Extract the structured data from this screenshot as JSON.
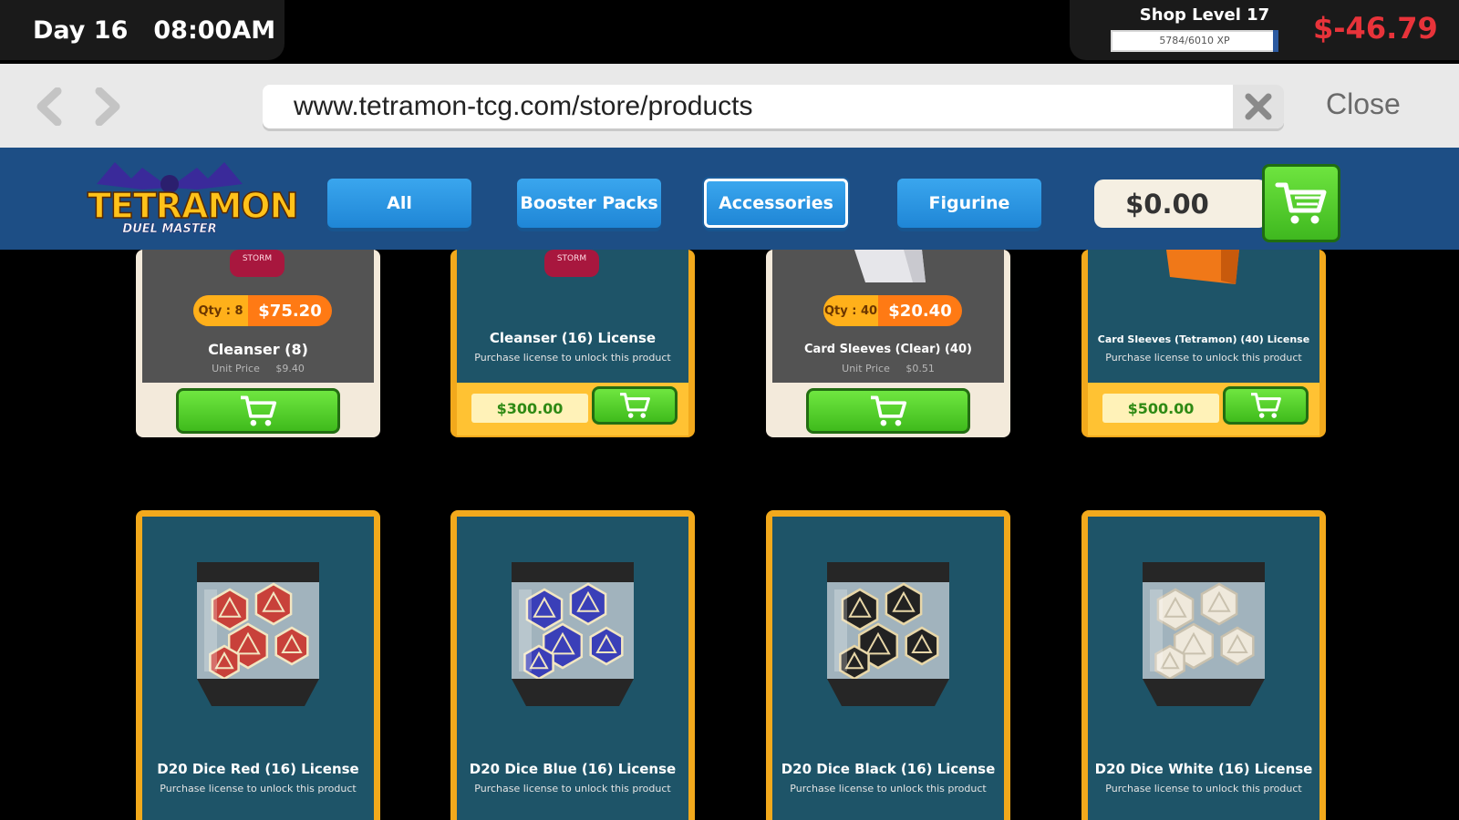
{
  "hud": {
    "day": "Day 16",
    "time": "08:00AM",
    "shop_level": "Shop Level 17",
    "xp_text": "5784/6010 XP",
    "xp_progress": 0.962,
    "money": "$-46.79",
    "money_color": "#e8333a"
  },
  "browser": {
    "url": "www.tetramon-tcg.com/store/products",
    "close_label": "Close"
  },
  "store": {
    "logo_title": "TETRAMON",
    "logo_subtitle": "DUEL MASTER",
    "tabs": [
      {
        "label": "All",
        "active": false
      },
      {
        "label": "Booster Packs",
        "active": false
      },
      {
        "label": "Accessories",
        "active": true
      },
      {
        "label": "Figurine",
        "active": false
      }
    ],
    "cart_total": "$0.00"
  },
  "products_row1": [
    {
      "name": "Cleanser (8)",
      "type": "owned",
      "qty": "Qty : 8",
      "price": "$75.20",
      "unit_label": "Unit Price",
      "unit_price": "$9.40",
      "image_label": "STORM"
    },
    {
      "name": "Cleanser (16) License",
      "type": "license",
      "subtitle": "Purchase license to unlock this product",
      "license_price": "$300.00",
      "image_label": "STORM"
    },
    {
      "name": "Card Sleeves (Clear) (40)",
      "type": "owned",
      "qty": "Qty : 40",
      "price": "$20.40",
      "unit_label": "Unit Price",
      "unit_price": "$0.51"
    },
    {
      "name": "Card Sleeves (Tetramon) (40) License",
      "type": "license",
      "subtitle": "Purchase license to unlock this product",
      "license_price": "$500.00"
    }
  ],
  "products_row2": [
    {
      "name": "D20 Dice Red (16) License",
      "subtitle": "Purchase license to unlock this product",
      "dice_color": "#c8413a",
      "edge_color": "#f2e6c2"
    },
    {
      "name": "D20 Dice Blue (16) License",
      "subtitle": "Purchase license to unlock this product",
      "dice_color": "#3a3fb8",
      "edge_color": "#f2e6c2"
    },
    {
      "name": "D20 Dice Black (16) License",
      "subtitle": "Purchase license to unlock this product",
      "dice_color": "#222222",
      "edge_color": "#e8d7a8"
    },
    {
      "name": "D20 Dice White (16) License",
      "subtitle": "Purchase license to unlock this product",
      "dice_color": "#efe9dc",
      "edge_color": "#c9c1ae"
    }
  ]
}
